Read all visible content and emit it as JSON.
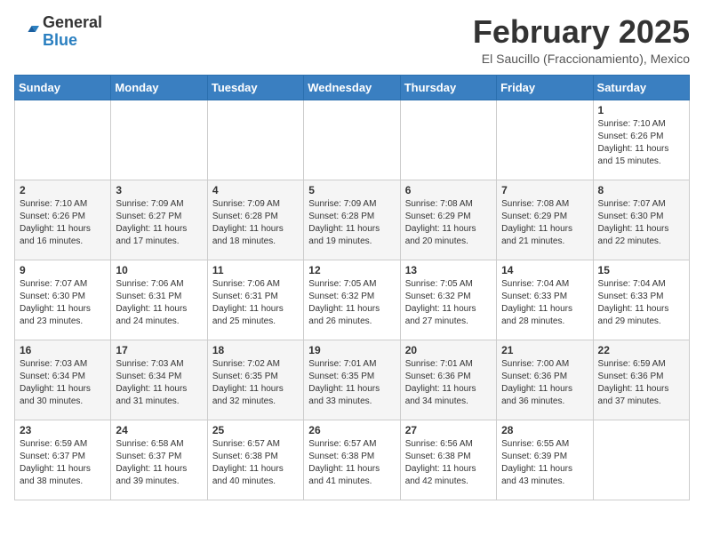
{
  "header": {
    "logo_general": "General",
    "logo_blue": "Blue",
    "month_title": "February 2025",
    "location": "El Saucillo (Fraccionamiento), Mexico"
  },
  "weekdays": [
    "Sunday",
    "Monday",
    "Tuesday",
    "Wednesday",
    "Thursday",
    "Friday",
    "Saturday"
  ],
  "weeks": [
    [
      {
        "day": "",
        "info": ""
      },
      {
        "day": "",
        "info": ""
      },
      {
        "day": "",
        "info": ""
      },
      {
        "day": "",
        "info": ""
      },
      {
        "day": "",
        "info": ""
      },
      {
        "day": "",
        "info": ""
      },
      {
        "day": "1",
        "info": "Sunrise: 7:10 AM\nSunset: 6:26 PM\nDaylight: 11 hours\nand 15 minutes."
      }
    ],
    [
      {
        "day": "2",
        "info": "Sunrise: 7:10 AM\nSunset: 6:26 PM\nDaylight: 11 hours\nand 16 minutes."
      },
      {
        "day": "3",
        "info": "Sunrise: 7:09 AM\nSunset: 6:27 PM\nDaylight: 11 hours\nand 17 minutes."
      },
      {
        "day": "4",
        "info": "Sunrise: 7:09 AM\nSunset: 6:28 PM\nDaylight: 11 hours\nand 18 minutes."
      },
      {
        "day": "5",
        "info": "Sunrise: 7:09 AM\nSunset: 6:28 PM\nDaylight: 11 hours\nand 19 minutes."
      },
      {
        "day": "6",
        "info": "Sunrise: 7:08 AM\nSunset: 6:29 PM\nDaylight: 11 hours\nand 20 minutes."
      },
      {
        "day": "7",
        "info": "Sunrise: 7:08 AM\nSunset: 6:29 PM\nDaylight: 11 hours\nand 21 minutes."
      },
      {
        "day": "8",
        "info": "Sunrise: 7:07 AM\nSunset: 6:30 PM\nDaylight: 11 hours\nand 22 minutes."
      }
    ],
    [
      {
        "day": "9",
        "info": "Sunrise: 7:07 AM\nSunset: 6:30 PM\nDaylight: 11 hours\nand 23 minutes."
      },
      {
        "day": "10",
        "info": "Sunrise: 7:06 AM\nSunset: 6:31 PM\nDaylight: 11 hours\nand 24 minutes."
      },
      {
        "day": "11",
        "info": "Sunrise: 7:06 AM\nSunset: 6:31 PM\nDaylight: 11 hours\nand 25 minutes."
      },
      {
        "day": "12",
        "info": "Sunrise: 7:05 AM\nSunset: 6:32 PM\nDaylight: 11 hours\nand 26 minutes."
      },
      {
        "day": "13",
        "info": "Sunrise: 7:05 AM\nSunset: 6:32 PM\nDaylight: 11 hours\nand 27 minutes."
      },
      {
        "day": "14",
        "info": "Sunrise: 7:04 AM\nSunset: 6:33 PM\nDaylight: 11 hours\nand 28 minutes."
      },
      {
        "day": "15",
        "info": "Sunrise: 7:04 AM\nSunset: 6:33 PM\nDaylight: 11 hours\nand 29 minutes."
      }
    ],
    [
      {
        "day": "16",
        "info": "Sunrise: 7:03 AM\nSunset: 6:34 PM\nDaylight: 11 hours\nand 30 minutes."
      },
      {
        "day": "17",
        "info": "Sunrise: 7:03 AM\nSunset: 6:34 PM\nDaylight: 11 hours\nand 31 minutes."
      },
      {
        "day": "18",
        "info": "Sunrise: 7:02 AM\nSunset: 6:35 PM\nDaylight: 11 hours\nand 32 minutes."
      },
      {
        "day": "19",
        "info": "Sunrise: 7:01 AM\nSunset: 6:35 PM\nDaylight: 11 hours\nand 33 minutes."
      },
      {
        "day": "20",
        "info": "Sunrise: 7:01 AM\nSunset: 6:36 PM\nDaylight: 11 hours\nand 34 minutes."
      },
      {
        "day": "21",
        "info": "Sunrise: 7:00 AM\nSunset: 6:36 PM\nDaylight: 11 hours\nand 36 minutes."
      },
      {
        "day": "22",
        "info": "Sunrise: 6:59 AM\nSunset: 6:36 PM\nDaylight: 11 hours\nand 37 minutes."
      }
    ],
    [
      {
        "day": "23",
        "info": "Sunrise: 6:59 AM\nSunset: 6:37 PM\nDaylight: 11 hours\nand 38 minutes."
      },
      {
        "day": "24",
        "info": "Sunrise: 6:58 AM\nSunset: 6:37 PM\nDaylight: 11 hours\nand 39 minutes."
      },
      {
        "day": "25",
        "info": "Sunrise: 6:57 AM\nSunset: 6:38 PM\nDaylight: 11 hours\nand 40 minutes."
      },
      {
        "day": "26",
        "info": "Sunrise: 6:57 AM\nSunset: 6:38 PM\nDaylight: 11 hours\nand 41 minutes."
      },
      {
        "day": "27",
        "info": "Sunrise: 6:56 AM\nSunset: 6:38 PM\nDaylight: 11 hours\nand 42 minutes."
      },
      {
        "day": "28",
        "info": "Sunrise: 6:55 AM\nSunset: 6:39 PM\nDaylight: 11 hours\nand 43 minutes."
      },
      {
        "day": "",
        "info": ""
      }
    ]
  ]
}
